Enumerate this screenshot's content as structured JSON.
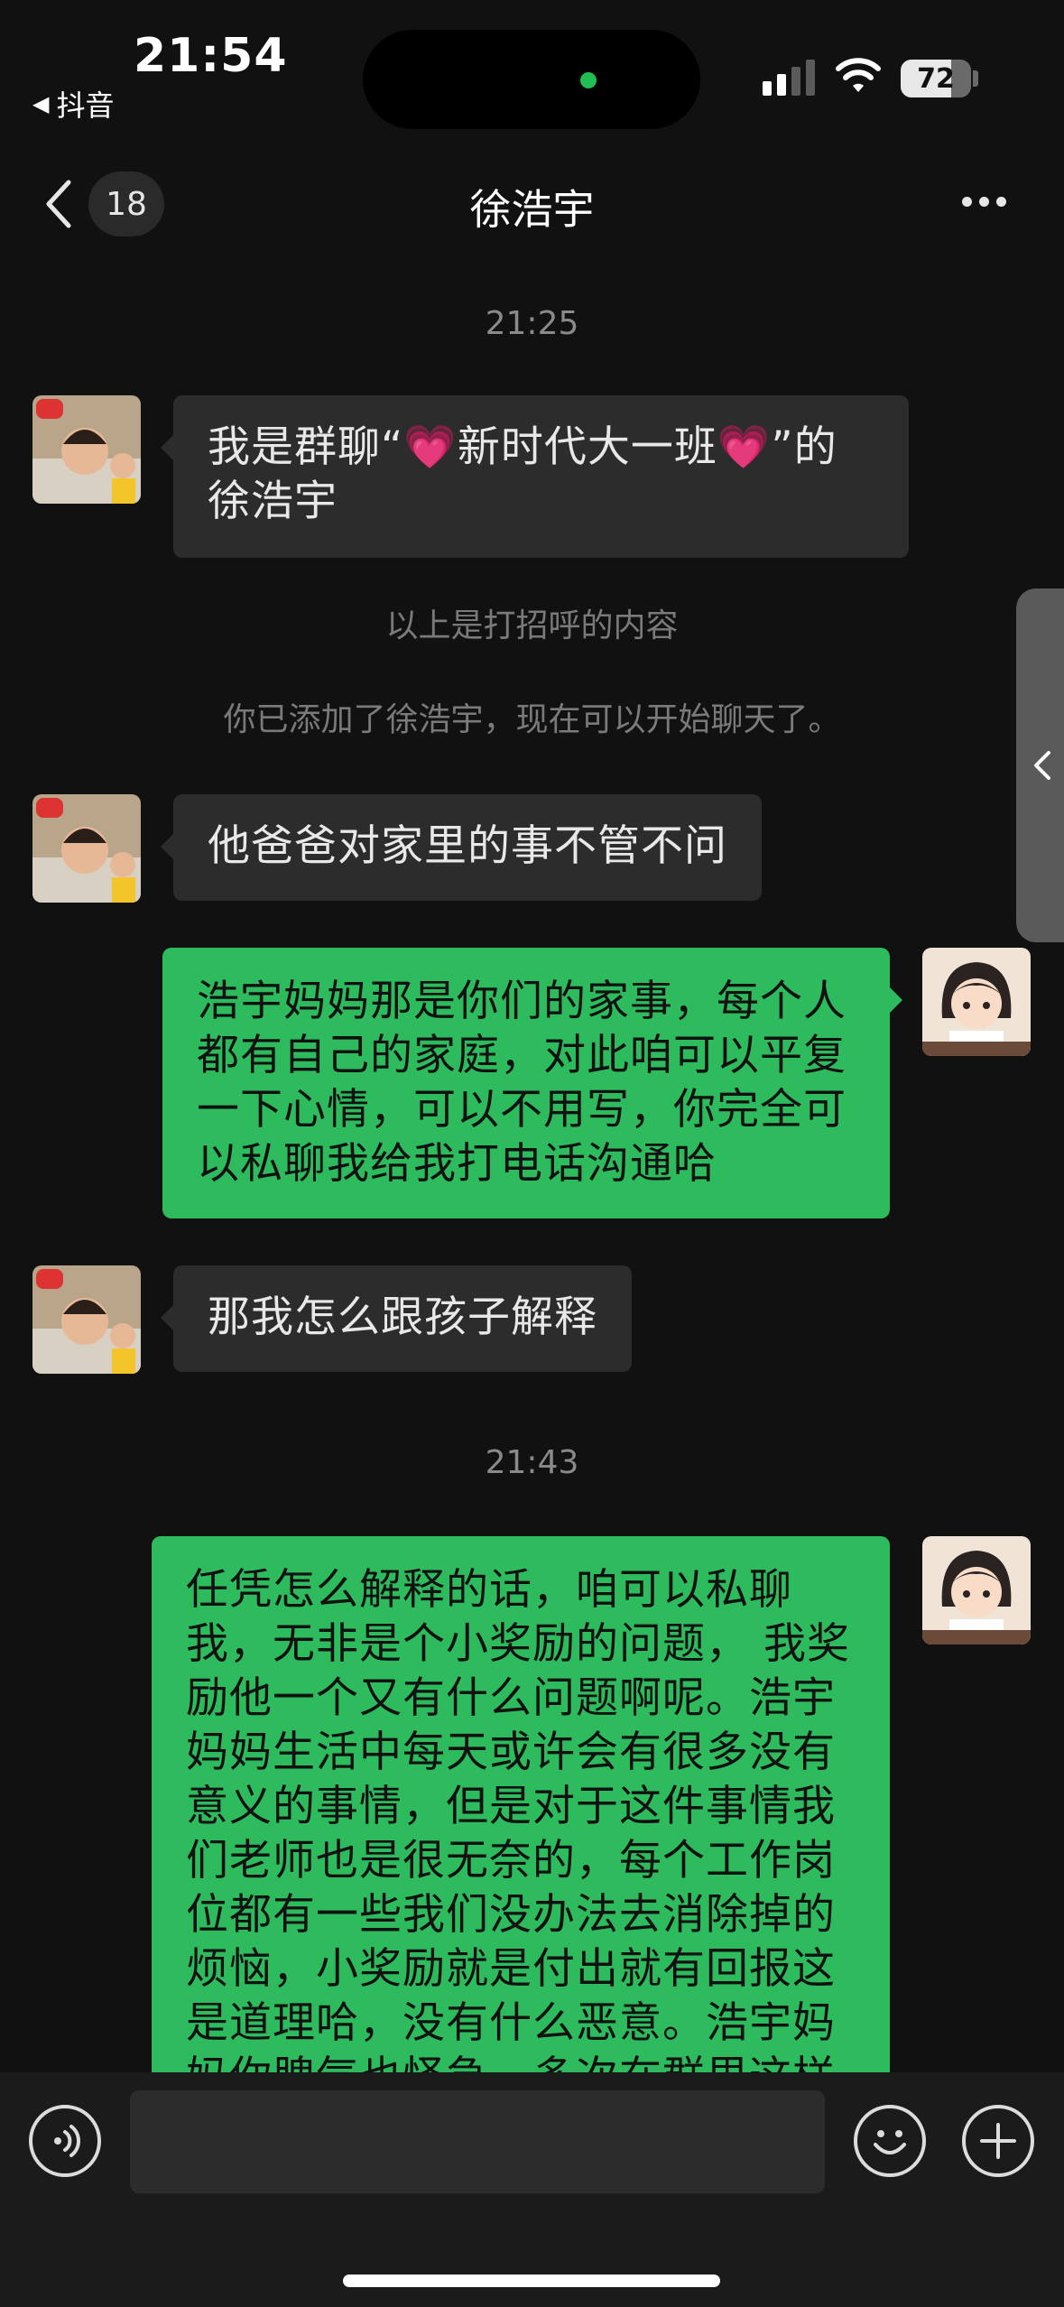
{
  "status_bar": {
    "time": "21:54",
    "back_app": "抖音",
    "battery": "72",
    "battery_level_pct": 72,
    "signal_bars_active": 2
  },
  "nav": {
    "unread_count": "18",
    "title": "徐浩宇"
  },
  "chat": {
    "timestamp_1": "21:25",
    "msg1_pre": "我是群聊“",
    "msg1_group": "新时代大一班",
    "msg1_post": "”的徐浩宇",
    "msg1_heart": "💗",
    "system_1": "以上是打招呼的内容",
    "system_2": "你已添加了徐浩宇，现在可以开始聊天了。",
    "msg2": "他爸爸对家里的事不管不问",
    "msg3": "浩宇妈妈那是你们的家事，每个人都有自己的家庭，对此咱可以平复一下心情，可以不用写，你完全可以私聊我给我打电话沟通哈",
    "msg4": "那我怎么跟孩子解释",
    "timestamp_2": "21:43",
    "msg5": "任凭怎么解释的话，咱可以私聊我，无非是个小奖励的问题， 我奖励他一个又有什么问题啊呢。浩宇妈妈生活中每天或许会有很多没有意义的事情，但是对于这件事情我们老师也是很无奈的，每个工作岗位都有一些我们没办法去消除掉的烦恼，小奖励就是付出就有回报这是道理哈，没有什么恶意。浩宇妈妈你脾气也怪急，多次在群里这样"
  },
  "icons": {
    "voice": "voice-icon",
    "emoji": "emoji-icon",
    "plus": "plus-icon",
    "back": "chevron-left-icon",
    "more": "more-icon"
  },
  "colors": {
    "background": "#111111",
    "incoming_bubble": "#2c2c2c",
    "outgoing_bubble": "#2dbb5d",
    "input_bar": "#1b1b1b"
  }
}
